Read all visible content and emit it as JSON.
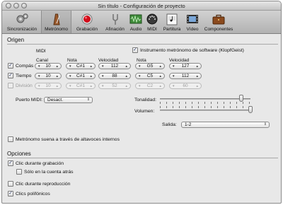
{
  "window": {
    "title": "Sin título - Configuración de proyecto"
  },
  "toolbar": {
    "items": [
      {
        "label": "Sincronización",
        "icon": "sync-gear-icon"
      },
      {
        "label": "Metrónomo",
        "icon": "metronome-icon",
        "selected": true
      },
      {
        "label": "Grabación",
        "icon": "record-icon"
      },
      {
        "label": "Afinación",
        "icon": "tuning-fork-icon"
      },
      {
        "label": "Audio",
        "icon": "audio-waveform-icon"
      },
      {
        "label": "MIDI",
        "icon": "midi-port-icon"
      },
      {
        "label": "Partitura",
        "icon": "score-icon"
      },
      {
        "label": "Vídeo",
        "icon": "film-icon"
      },
      {
        "label": "Componentes",
        "icon": "briefcase-icon"
      }
    ]
  },
  "origin": {
    "title": "Origen",
    "midi_label": "MIDI",
    "headers": {
      "canal": "Canal",
      "nota": "Nota",
      "velocidad": "Velocidad",
      "nota2": "Nota",
      "velocidad2": "Velocidad"
    },
    "software_instrument_label": "Instrumento metrónomo de software (KlopfGeist)",
    "software_instrument_checked": true,
    "rows": [
      {
        "label": "Compás",
        "checked": true,
        "enabled": true,
        "canal": "10",
        "nota": "C#1",
        "velocidad": "112",
        "nota2": "G5",
        "velocidad2": "127"
      },
      {
        "label": "Tiempo",
        "checked": true,
        "enabled": true,
        "canal": "10",
        "nota": "C#1",
        "velocidad": "88",
        "nota2": "C5",
        "velocidad2": "112"
      },
      {
        "label": "División",
        "checked": false,
        "enabled": false,
        "canal": "10",
        "nota": "C#1",
        "velocidad": "52",
        "nota2": "C2",
        "velocidad2": "60"
      }
    ],
    "midi_port_label": "Puerto MIDI:",
    "midi_port_value": "Desact.",
    "tonalidad_label": "Tonalidad:",
    "tonalidad_value": 0.9,
    "volumen_label": "Volumen:",
    "volumen_value": 1.0,
    "salida_label": "Salida:",
    "salida_value": "1-2",
    "internal_speakers_label": "Metrónomo suena a través de altavoces internos",
    "internal_speakers_checked": false
  },
  "options": {
    "title": "Opciones",
    "items": [
      {
        "label": "Clic durante grabación",
        "checked": true
      },
      {
        "label": "Sólo en la cuenta atrás",
        "checked": false
      },
      {
        "label": "Clic durante reproducción",
        "checked": false
      },
      {
        "label": "Clics polifónicos",
        "checked": true
      }
    ]
  }
}
